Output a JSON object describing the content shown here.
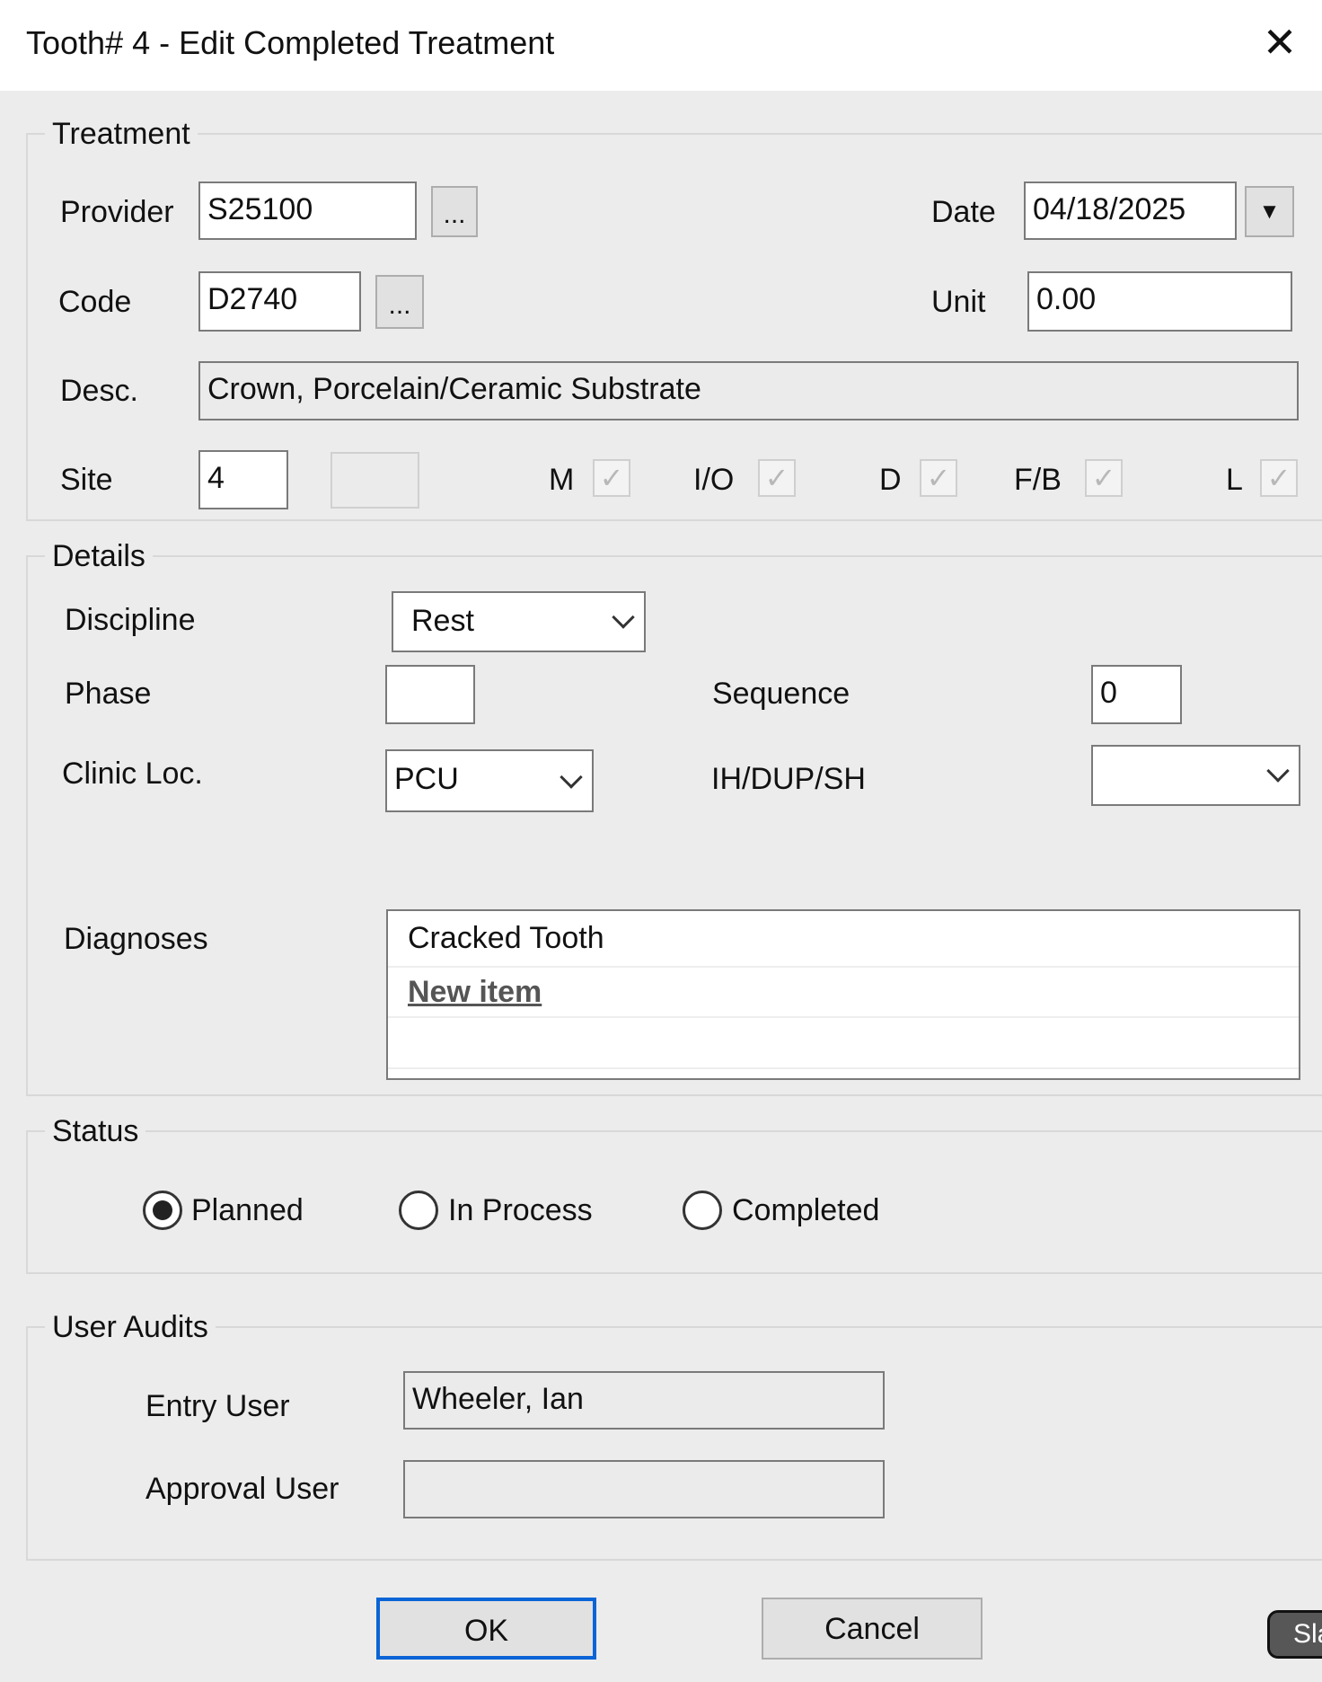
{
  "window": {
    "title": "Tooth# 4 - Edit Completed Treatment",
    "close_icon": "close-icon"
  },
  "treatment": {
    "legend": "Treatment",
    "provider_label": "Provider",
    "provider_value": "S25100",
    "browse_label": "...",
    "date_label": "Date",
    "date_value": "04/18/2025",
    "code_label": "Code",
    "code_value": "D2740",
    "unit_label": "Unit",
    "unit_value": "0.00",
    "desc_label": "Desc.",
    "desc_value": "Crown, Porcelain/Ceramic Substrate",
    "site_label": "Site",
    "site_value": "4",
    "surfaces": [
      {
        "label": "M",
        "checked": true
      },
      {
        "label": "I/O",
        "checked": true
      },
      {
        "label": "D",
        "checked": true
      },
      {
        "label": "F/B",
        "checked": true
      },
      {
        "label": "L",
        "checked": true
      }
    ]
  },
  "details": {
    "legend": "Details",
    "discipline_label": "Discipline",
    "discipline_value": "Rest",
    "phase_label": "Phase",
    "phase_value": "",
    "sequence_label": "Sequence",
    "sequence_value": "0",
    "clinic_label": "Clinic Loc.",
    "clinic_value": "PCU",
    "ih_label": "IH/DUP/SH",
    "ih_value": "",
    "diagnoses_label": "Diagnoses",
    "diagnoses": [
      "Cracked Tooth"
    ],
    "new_item": "New item"
  },
  "status": {
    "legend": "Status",
    "options": [
      "Planned",
      "In Process",
      "Completed"
    ],
    "selected": "Planned"
  },
  "audits": {
    "legend": "User Audits",
    "entry_label": "Entry User",
    "entry_value": "Wheeler, Ian",
    "approval_label": "Approval User",
    "approval_value": ""
  },
  "buttons": {
    "ok": "OK",
    "cancel": "Cancel"
  },
  "tooltip": "Sla"
}
